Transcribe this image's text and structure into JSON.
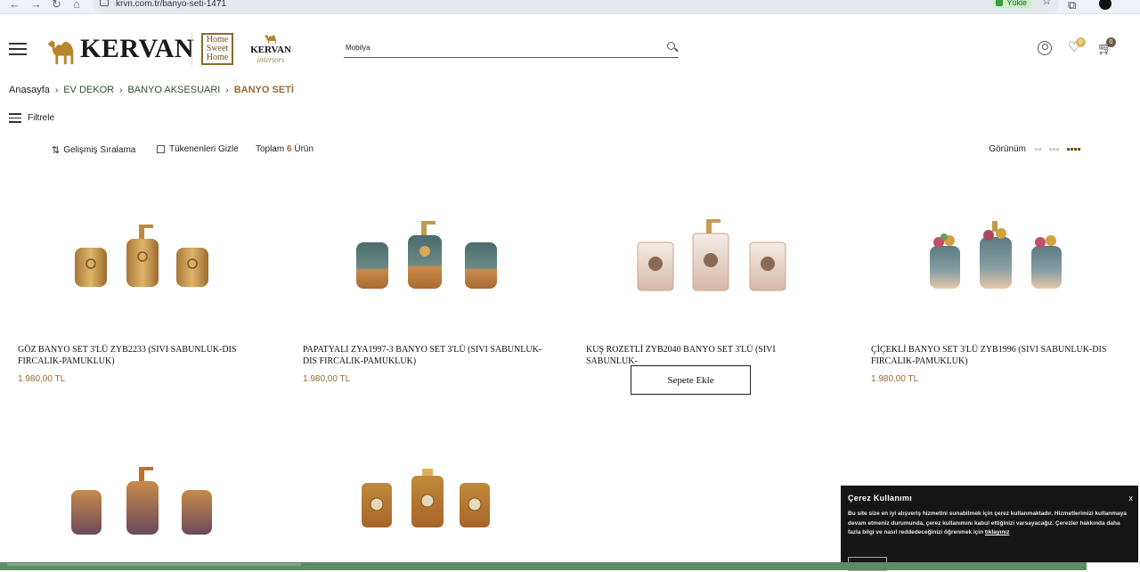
{
  "browser": {
    "url": "krvn.com.tr/banyo-seti-1471",
    "install_label": "Yükle"
  },
  "header": {
    "logo_text": "KERVAN",
    "home_sweet_home": [
      "Home",
      "Sweet",
      "Home"
    ],
    "interiors_brand": "KERVAN",
    "interiors_sub": "interiors",
    "search_value": "Mobilya",
    "wishlist_count": "0",
    "cart_count": "0"
  },
  "breadcrumb": {
    "home": "Anasayfa",
    "level1": "EV DEKOR",
    "level2": "BANYO AKSESUARI",
    "current": "BANYO SETİ"
  },
  "filter_label": "Filtrele",
  "toolbar": {
    "sort_label": "Gelişmiş Sıralama",
    "hide_label": "Tükenenleri Gizle",
    "total_prefix": "Toplam",
    "total_count": "6",
    "total_suffix": "Ürün",
    "view_label": "Görünüm"
  },
  "products": [
    {
      "name": "GÖZ BANYO SET 3'LÜ ZYB2233 (SIVI SABUNLUK-DIS FIRCALIK-PAMUKLUK)",
      "price": "1.980,00 TL",
      "style": "gold"
    },
    {
      "name": "PAPATYALI ZYA1997-3 BANYO SET 3'LÜ (SIVI SABUNLUK-DIS FIRCALIK-PAMUKLUK)",
      "price": "1.980,00 TL",
      "style": "teal"
    },
    {
      "name": "KUŞ ROZETLİ ZYB2040 BANYO SET 3'LÜ (SIVI SABUNLUK-",
      "price": "",
      "add_to_cart": "Sepete Ekle",
      "style": "white"
    },
    {
      "name": "ÇİÇEKLİ BANYO SET 3'LÜ ZYB1996 (SIVI SABUNLUK-DIS FIRCALIK-PAMUKLUK)",
      "price": "1.980,00 TL",
      "style": "floral"
    },
    {
      "name": "",
      "price": "",
      "style": "bronze"
    },
    {
      "name": "",
      "price": "",
      "style": "amber"
    }
  ],
  "cookie": {
    "title": "Çerez Kullanımı",
    "text": "Bu site size en iyi alışveriş hizmetini sunabilmek için çerez kullanmaktadır. Hizmetlerimizi kullanmaya devam etmeniz durumunda, çerez kullanımını kabul ettiğinizi varsayacağız. Çerezler hakkında daha fazla bilgi ve nasıl reddedeceğinizi öğrenmek için",
    "link": "tıklayınız",
    "close": "x"
  },
  "colors": {
    "accent": "#9c6a34",
    "breadcrumb_green": "#2e5230",
    "cookie_bg": "#151515"
  }
}
